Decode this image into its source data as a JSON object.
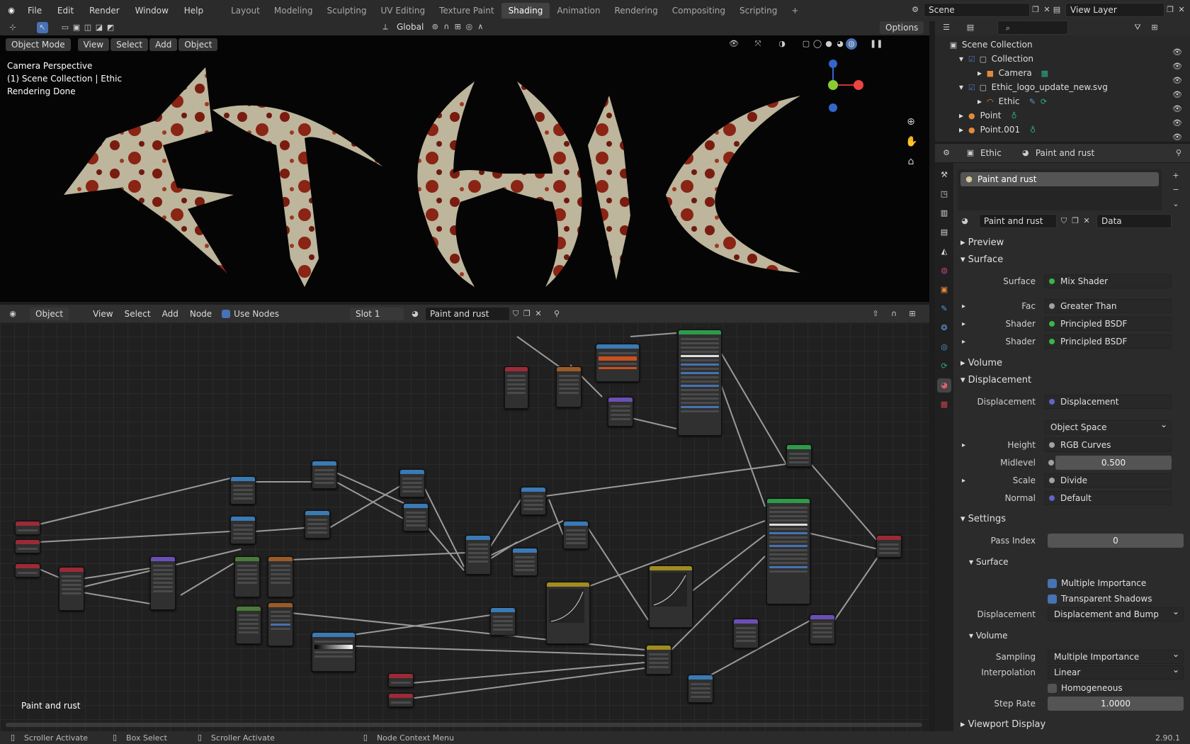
{
  "app": {
    "logo_icon": "blender-logo-icon"
  },
  "menu": [
    "File",
    "Edit",
    "Render",
    "Window",
    "Help"
  ],
  "workspaces": [
    "Layout",
    "Modeling",
    "Sculpting",
    "UV Editing",
    "Texture Paint",
    "Shading",
    "Animation",
    "Rendering",
    "Compositing",
    "Scripting"
  ],
  "active_workspace": "Shading",
  "scene": {
    "name": "Scene",
    "view_layer": "View Layer"
  },
  "viewport": {
    "transform_orientation": "Global",
    "options": "Options",
    "mode": "Object Mode",
    "menus": [
      "View",
      "Select",
      "Add",
      "Object"
    ],
    "overlay_text": [
      "Camera Perspective",
      "(1) Scene Collection | Ethic",
      "Rendering Done"
    ],
    "logo_text": "ETHIC"
  },
  "node_editor": {
    "type": "Object",
    "menus": [
      "View",
      "Select",
      "Add",
      "Node"
    ],
    "use_nodes_label": "Use Nodes",
    "slot": "Slot 1",
    "material": "Paint and rust",
    "footer_label": "Paint and rust"
  },
  "outliner": {
    "items": [
      {
        "label": "Scene Collection",
        "indent": 0,
        "icon": "scene-collection-icon"
      },
      {
        "label": "Collection",
        "indent": 1,
        "icon": "collection-icon"
      },
      {
        "label": "Camera",
        "indent": 2,
        "icon": "camera-icon"
      },
      {
        "label": "Ethic_logo_update_new.svg",
        "indent": 1,
        "icon": "collection-icon"
      },
      {
        "label": "Ethic",
        "indent": 2,
        "icon": "curve-icon"
      },
      {
        "label": "Point",
        "indent": 1,
        "icon": "light-icon"
      },
      {
        "label": "Point.001",
        "indent": 1,
        "icon": "light-icon"
      }
    ]
  },
  "properties": {
    "object": "Ethic",
    "material_tab": "Paint and rust",
    "slot_item": "Paint and rust",
    "material_name": "Paint and rust",
    "data_mode": "Data",
    "sections": {
      "preview": "Preview",
      "surface": "Surface",
      "volume": "Volume",
      "displacement": "Displacement",
      "settings": "Settings",
      "settings_surface": "Surface",
      "settings_volume": "Volume",
      "viewport_display": "Viewport Display"
    },
    "surface": [
      {
        "label": "Surface",
        "value": "Mix Shader",
        "color": "#39b54a"
      },
      {
        "label": "Fac",
        "value": "Greater Than",
        "color": "#a1a1a1"
      },
      {
        "label": "Shader",
        "value": "Principled BSDF",
        "color": "#39b54a"
      },
      {
        "label": "Shader",
        "value": "Principled BSDF",
        "color": "#39b54a"
      }
    ],
    "displacement": [
      {
        "label": "Displacement",
        "value": "Displacement",
        "color": "#6363c7"
      },
      {
        "label": "",
        "value": "Object Space",
        "color": ""
      },
      {
        "label": "Height",
        "value": "RGB Curves",
        "color": "#a1a1a1"
      },
      {
        "label": "Midlevel",
        "value": "0.500",
        "color": "#a1a1a1"
      },
      {
        "label": "Scale",
        "value": "Divide",
        "color": "#a1a1a1"
      },
      {
        "label": "Normal",
        "value": "Default",
        "color": "#6363c7"
      }
    ],
    "settings": {
      "pass_index_label": "Pass Index",
      "pass_index": "0",
      "multiple_importance": "Multiple Importance",
      "transparent_shadows": "Transparent Shadows",
      "displacement_label": "Displacement",
      "displacement_method": "Displacement and Bump",
      "sampling_label": "Sampling",
      "sampling": "Multiple Importance",
      "interpolation_label": "Interpolation",
      "interpolation": "Linear",
      "homogeneous": "Homogeneous",
      "step_rate_label": "Step Rate",
      "step_rate": "1.0000"
    }
  },
  "status": {
    "items": [
      "Scroller Activate",
      "Box Select",
      "Scroller Activate",
      "Node Context Menu"
    ],
    "version": "2.90.1"
  },
  "colors": {
    "accent": "#4772b3",
    "shader_socket": "#39b54a",
    "vector_socket": "#6363c7",
    "grey_socket": "#a1a1a1"
  }
}
